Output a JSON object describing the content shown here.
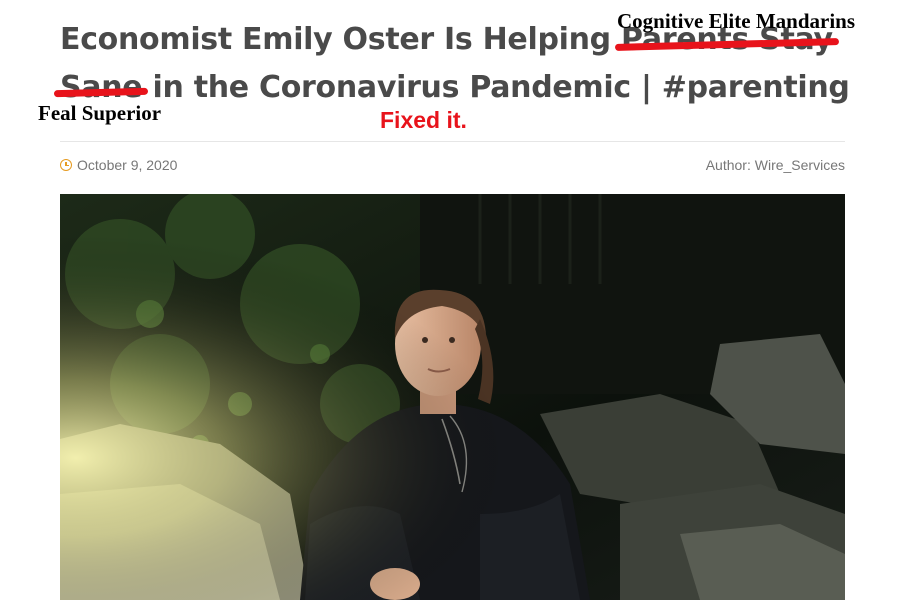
{
  "article": {
    "title_line1_prefix": "Economist Emily Oster Is Helping",
    "title_struck_1": "Parents Stay",
    "title_struck_2": "Sane",
    "title_line2_suffix": "in the Coronavirus Pandemic | #parenting",
    "date": "October 9, 2020",
    "author": "Author: Wire_Services"
  },
  "annotations": {
    "replacement_top": "Cognitive Elite Mandarins",
    "replacement_left": "Feal Superior",
    "note": "Fixed it.",
    "strike_color": "#e8131b"
  },
  "icons": {
    "date_icon": "clock-icon"
  },
  "colors": {
    "headline": "#4a4a4a",
    "meta_text": "#777777",
    "accent": "#e69b22"
  }
}
